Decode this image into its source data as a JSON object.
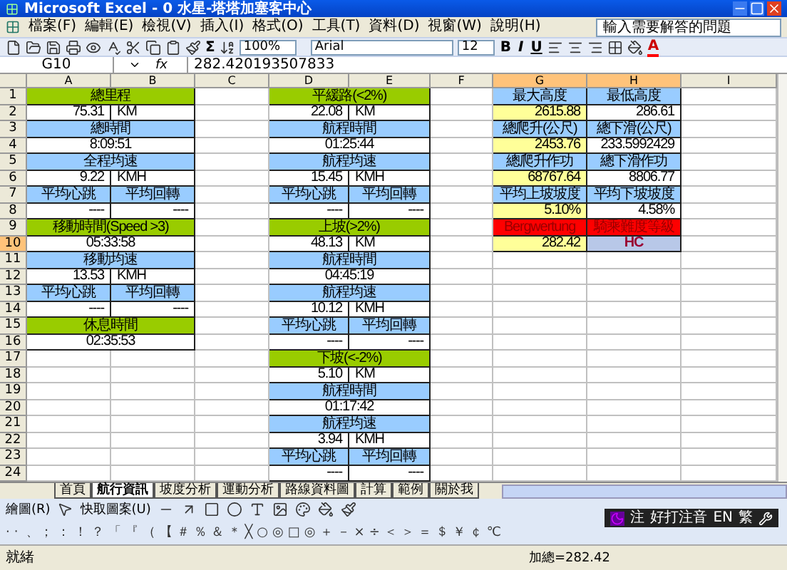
{
  "window": {
    "title": "Microsoft Excel - 0 水星-塔塔加塞客中心"
  },
  "menu": [
    "檔案(F)",
    "編輯(E)",
    "檢視(V)",
    "插入(I)",
    "格式(O)",
    "工具(T)",
    "資料(D)",
    "視窗(W)",
    "說明(H)"
  ],
  "help_box": {
    "placeholder": "輸入需要解答的問題"
  },
  "toolbar": {
    "sum": "Σ",
    "zoom": "100%",
    "font": "Arial",
    "size": "12",
    "format": [
      "B",
      "I",
      "U"
    ],
    "font_color": "A"
  },
  "formula_bar": {
    "name_box": "G10",
    "fx": "fx",
    "value": "282.420193507833"
  },
  "columns": [
    {
      "label": "A",
      "selected": false
    },
    {
      "label": "B",
      "selected": false
    },
    {
      "label": "C",
      "selected": false
    },
    {
      "label": "D",
      "selected": false
    },
    {
      "label": "E",
      "selected": false
    },
    {
      "label": "F",
      "selected": false
    },
    {
      "label": "G",
      "selected": true
    },
    {
      "label": "H",
      "selected": true
    },
    {
      "label": "I",
      "selected": false
    }
  ],
  "rows": [
    {
      "label": "1",
      "selected": false,
      "cells": [
        {
          "kind": "section",
          "merged": true,
          "text": "總里程"
        },
        {
          "kind": "blank",
          "merged": false
        },
        {
          "kind": "section",
          "merged": true,
          "text": "平緩路(<2%)"
        },
        {
          "kind": "blank",
          "merged": false
        },
        {
          "kind": "label",
          "merged": false,
          "text": "最大高度"
        },
        {
          "kind": "label",
          "merged": false,
          "text": "最低高度"
        },
        {
          "kind": "blank",
          "merged": false
        }
      ]
    },
    {
      "label": "2",
      "selected": false,
      "cells": [
        {
          "kind": "number",
          "merged": false,
          "text": "75.31"
        },
        {
          "kind": "unit",
          "merged": false,
          "text": "KM"
        },
        {
          "kind": "blank",
          "merged": false
        },
        {
          "kind": "number",
          "merged": false,
          "text": "22.08"
        },
        {
          "kind": "unit",
          "merged": false,
          "text": "KM"
        },
        {
          "kind": "blank",
          "merged": false
        },
        {
          "kind": "highlight",
          "merged": false,
          "text": "2615.88"
        },
        {
          "kind": "number",
          "merged": false,
          "text": "286.61"
        },
        {
          "kind": "blank",
          "merged": false
        }
      ]
    },
    {
      "label": "3",
      "selected": false,
      "cells": [
        {
          "kind": "label",
          "merged": true,
          "text": "總時間"
        },
        {
          "kind": "blank",
          "merged": false
        },
        {
          "kind": "label",
          "merged": true,
          "text": "航程時間"
        },
        {
          "kind": "blank",
          "merged": false
        },
        {
          "kind": "label",
          "merged": false,
          "text": "總爬升(公尺)"
        },
        {
          "kind": "label",
          "merged": false,
          "text": "總下滑(公尺)"
        },
        {
          "kind": "blank",
          "merged": false
        }
      ]
    },
    {
      "label": "4",
      "selected": false,
      "cells": [
        {
          "kind": "time",
          "merged": true,
          "text": "8:09:51"
        },
        {
          "kind": "blank",
          "merged": false
        },
        {
          "kind": "time",
          "merged": true,
          "text": "01:25:44"
        },
        {
          "kind": "blank",
          "merged": false
        },
        {
          "kind": "highlight",
          "merged": false,
          "text": "2453.76"
        },
        {
          "kind": "number",
          "merged": false,
          "text": "233.5992429"
        },
        {
          "kind": "blank",
          "merged": false
        }
      ]
    },
    {
      "label": "5",
      "selected": false,
      "cells": [
        {
          "kind": "label",
          "merged": true,
          "text": "全程均速"
        },
        {
          "kind": "blank",
          "merged": false
        },
        {
          "kind": "label",
          "merged": true,
          "text": "航程均速"
        },
        {
          "kind": "blank",
          "merged": false
        },
        {
          "kind": "label",
          "merged": false,
          "text": "總爬升作功"
        },
        {
          "kind": "label",
          "merged": false,
          "text": "總下滑作功"
        },
        {
          "kind": "blank",
          "merged": false
        }
      ]
    },
    {
      "label": "6",
      "selected": false,
      "cells": [
        {
          "kind": "number",
          "merged": false,
          "text": "9.22"
        },
        {
          "kind": "unit",
          "merged": false,
          "text": "KMH"
        },
        {
          "kind": "blank",
          "merged": false
        },
        {
          "kind": "number",
          "merged": false,
          "text": "15.45"
        },
        {
          "kind": "unit",
          "merged": false,
          "text": "KMH"
        },
        {
          "kind": "blank",
          "merged": false
        },
        {
          "kind": "highlight",
          "merged": false,
          "text": "68767.64"
        },
        {
          "kind": "number",
          "merged": false,
          "text": "8806.77"
        },
        {
          "kind": "blank",
          "merged": false
        }
      ]
    },
    {
      "label": "7",
      "selected": false,
      "cells": [
        {
          "kind": "label",
          "merged": false,
          "text": "平均心跳"
        },
        {
          "kind": "label",
          "merged": false,
          "text": "平均回轉"
        },
        {
          "kind": "blank",
          "merged": false
        },
        {
          "kind": "label",
          "merged": false,
          "text": "平均心跳"
        },
        {
          "kind": "label",
          "merged": false,
          "text": "平均回轉"
        },
        {
          "kind": "blank",
          "merged": false
        },
        {
          "kind": "label",
          "merged": false,
          "text": "平均上坡坡度"
        },
        {
          "kind": "label",
          "merged": false,
          "text": "平均下坡坡度"
        },
        {
          "kind": "blank",
          "merged": false
        }
      ]
    },
    {
      "label": "8",
      "selected": false,
      "cells": [
        {
          "kind": "number",
          "merged": false,
          "text": "----"
        },
        {
          "kind": "number",
          "merged": false,
          "text": "----"
        },
        {
          "kind": "blank",
          "merged": false
        },
        {
          "kind": "number",
          "merged": false,
          "text": "----"
        },
        {
          "kind": "number",
          "merged": false,
          "text": "----"
        },
        {
          "kind": "blank",
          "merged": false
        },
        {
          "kind": "highlight",
          "merged": false,
          "text": "5.10%"
        },
        {
          "kind": "number",
          "merged": false,
          "text": "4.58%"
        },
        {
          "kind": "blank",
          "merged": false
        }
      ]
    },
    {
      "label": "9",
      "selected": false,
      "cells": [
        {
          "kind": "section",
          "merged": true,
          "text": "移動時間(Speed >3)"
        },
        {
          "kind": "blank",
          "merged": false
        },
        {
          "kind": "section",
          "merged": true,
          "text": "上坡(>2%)"
        },
        {
          "kind": "blank",
          "merged": false
        },
        {
          "kind": "alert",
          "merged": false,
          "text": "Bergwertung"
        },
        {
          "kind": "alert",
          "merged": false,
          "text": "騎乘難度等級"
        },
        {
          "kind": "blank",
          "merged": false
        }
      ]
    },
    {
      "label": "10",
      "selected": true,
      "cells": [
        {
          "kind": "time",
          "merged": true,
          "text": "05:33:58"
        },
        {
          "kind": "blank",
          "merged": false
        },
        {
          "kind": "number",
          "merged": false,
          "text": "48.13"
        },
        {
          "kind": "unit",
          "merged": false,
          "text": "KM"
        },
        {
          "kind": "blank",
          "merged": false
        },
        {
          "kind": "highlight",
          "merged": false,
          "text": "282.42"
        },
        {
          "kind": "grade",
          "merged": false,
          "text": "HC"
        },
        {
          "kind": "blank",
          "merged": false
        }
      ]
    },
    {
      "label": "11",
      "selected": false,
      "cells": [
        {
          "kind": "label",
          "merged": true,
          "text": "移動均速"
        },
        {
          "kind": "blank",
          "merged": false
        },
        {
          "kind": "label",
          "merged": true,
          "text": "航程時間"
        },
        {
          "kind": "blank",
          "merged": false
        },
        {
          "kind": "blank",
          "merged": false
        },
        {
          "kind": "blank",
          "merged": false
        },
        {
          "kind": "blank",
          "merged": false
        }
      ]
    },
    {
      "label": "12",
      "selected": false,
      "cells": [
        {
          "kind": "number",
          "merged": false,
          "text": "13.53"
        },
        {
          "kind": "unit",
          "merged": false,
          "text": "KMH"
        },
        {
          "kind": "blank",
          "merged": false
        },
        {
          "kind": "time",
          "merged": true,
          "text": "04:45:19"
        },
        {
          "kind": "blank",
          "merged": false
        },
        {
          "kind": "blank",
          "merged": false
        },
        {
          "kind": "blank",
          "merged": false
        },
        {
          "kind": "blank",
          "merged": false
        }
      ]
    },
    {
      "label": "13",
      "selected": false,
      "cells": [
        {
          "kind": "label",
          "merged": false,
          "text": "平均心跳"
        },
        {
          "kind": "label",
          "merged": false,
          "text": "平均回轉"
        },
        {
          "kind": "blank",
          "merged": false
        },
        {
          "kind": "label",
          "merged": true,
          "text": "航程均速"
        },
        {
          "kind": "blank",
          "merged": false
        },
        {
          "kind": "blank",
          "merged": false
        },
        {
          "kind": "blank",
          "merged": false
        },
        {
          "kind": "blank",
          "merged": false
        }
      ]
    },
    {
      "label": "14",
      "selected": false,
      "cells": [
        {
          "kind": "number",
          "merged": false,
          "text": "----"
        },
        {
          "kind": "number",
          "merged": false,
          "text": "----"
        },
        {
          "kind": "blank",
          "merged": false
        },
        {
          "kind": "number",
          "merged": false,
          "text": "10.12"
        },
        {
          "kind": "unit",
          "merged": false,
          "text": "KMH"
        },
        {
          "kind": "blank",
          "merged": false
        },
        {
          "kind": "blank",
          "merged": false
        },
        {
          "kind": "blank",
          "merged": false
        },
        {
          "kind": "blank",
          "merged": false
        }
      ]
    },
    {
      "label": "15",
      "selected": false,
      "cells": [
        {
          "kind": "section",
          "merged": true,
          "text": "休息時間"
        },
        {
          "kind": "blank",
          "merged": false
        },
        {
          "kind": "label",
          "merged": false,
          "text": "平均心跳"
        },
        {
          "kind": "label",
          "merged": false,
          "text": "平均回轉"
        },
        {
          "kind": "blank",
          "merged": false
        },
        {
          "kind": "blank",
          "merged": false
        },
        {
          "kind": "blank",
          "merged": false
        },
        {
          "kind": "blank",
          "merged": false
        }
      ]
    },
    {
      "label": "16",
      "selected": false,
      "cells": [
        {
          "kind": "time",
          "merged": true,
          "text": "02:35:53"
        },
        {
          "kind": "blank",
          "merged": false
        },
        {
          "kind": "number",
          "merged": false,
          "text": "----"
        },
        {
          "kind": "number",
          "merged": false,
          "text": "----"
        },
        {
          "kind": "blank",
          "merged": false
        },
        {
          "kind": "blank",
          "merged": false
        },
        {
          "kind": "blank",
          "merged": false
        },
        {
          "kind": "blank",
          "merged": false
        }
      ]
    },
    {
      "label": "17",
      "selected": false,
      "cells": [
        {
          "kind": "blank",
          "merged": false
        },
        {
          "kind": "blank",
          "merged": false
        },
        {
          "kind": "blank",
          "merged": false
        },
        {
          "kind": "section",
          "merged": true,
          "text": "下坡(<-2%)"
        },
        {
          "kind": "blank",
          "merged": false
        },
        {
          "kind": "blank",
          "merged": false
        },
        {
          "kind": "blank",
          "merged": false
        },
        {
          "kind": "blank",
          "merged": false
        }
      ]
    },
    {
      "label": "18",
      "selected": false,
      "cells": [
        {
          "kind": "blank",
          "merged": false
        },
        {
          "kind": "blank",
          "merged": false
        },
        {
          "kind": "blank",
          "merged": false
        },
        {
          "kind": "number",
          "merged": false,
          "text": "5.10"
        },
        {
          "kind": "unit",
          "merged": false,
          "text": "KM"
        },
        {
          "kind": "blank",
          "merged": false
        },
        {
          "kind": "blank",
          "merged": false
        },
        {
          "kind": "blank",
          "merged": false
        },
        {
          "kind": "blank",
          "merged": false
        }
      ]
    },
    {
      "label": "19",
      "selected": false,
      "cells": [
        {
          "kind": "blank",
          "merged": false
        },
        {
          "kind": "blank",
          "merged": false
        },
        {
          "kind": "blank",
          "merged": false
        },
        {
          "kind": "label",
          "merged": true,
          "text": "航程時間"
        },
        {
          "kind": "blank",
          "merged": false
        },
        {
          "kind": "blank",
          "merged": false
        },
        {
          "kind": "blank",
          "merged": false
        },
        {
          "kind": "blank",
          "merged": false
        }
      ]
    },
    {
      "label": "20",
      "selected": false,
      "cells": [
        {
          "kind": "blank",
          "merged": false
        },
        {
          "kind": "blank",
          "merged": false
        },
        {
          "kind": "blank",
          "merged": false
        },
        {
          "kind": "time",
          "merged": true,
          "text": "01:17:42"
        },
        {
          "kind": "blank",
          "merged": false
        },
        {
          "kind": "blank",
          "merged": false
        },
        {
          "kind": "blank",
          "merged": false
        },
        {
          "kind": "blank",
          "merged": false
        }
      ]
    },
    {
      "label": "21",
      "selected": false,
      "cells": [
        {
          "kind": "blank",
          "merged": false
        },
        {
          "kind": "blank",
          "merged": false
        },
        {
          "kind": "blank",
          "merged": false
        },
        {
          "kind": "label",
          "merged": true,
          "text": "航程均速"
        },
        {
          "kind": "blank",
          "merged": false
        },
        {
          "kind": "blank",
          "merged": false
        },
        {
          "kind": "blank",
          "merged": false
        },
        {
          "kind": "blank",
          "merged": false
        }
      ]
    },
    {
      "label": "22",
      "selected": false,
      "cells": [
        {
          "kind": "blank",
          "merged": false
        },
        {
          "kind": "blank",
          "merged": false
        },
        {
          "kind": "blank",
          "merged": false
        },
        {
          "kind": "number",
          "merged": false,
          "text": "3.94"
        },
        {
          "kind": "unit",
          "merged": false,
          "text": "KMH"
        },
        {
          "kind": "blank",
          "merged": false
        },
        {
          "kind": "blank",
          "merged": false
        },
        {
          "kind": "blank",
          "merged": false
        },
        {
          "kind": "blank",
          "merged": false
        }
      ]
    },
    {
      "label": "23",
      "selected": false,
      "cells": [
        {
          "kind": "blank",
          "merged": false
        },
        {
          "kind": "blank",
          "merged": false
        },
        {
          "kind": "blank",
          "merged": false
        },
        {
          "kind": "label",
          "merged": false,
          "text": "平均心跳"
        },
        {
          "kind": "label",
          "merged": false,
          "text": "平均回轉"
        },
        {
          "kind": "blank",
          "merged": false
        },
        {
          "kind": "blank",
          "merged": false
        },
        {
          "kind": "blank",
          "merged": false
        },
        {
          "kind": "blank",
          "merged": false
        }
      ]
    },
    {
      "label": "24",
      "selected": false,
      "cells": [
        {
          "kind": "blank",
          "merged": false
        },
        {
          "kind": "blank",
          "merged": false
        },
        {
          "kind": "blank",
          "merged": false
        },
        {
          "kind": "number",
          "merged": false,
          "text": "----"
        },
        {
          "kind": "number",
          "merged": false,
          "text": "----"
        },
        {
          "kind": "blank",
          "merged": false
        },
        {
          "kind": "blank",
          "merged": false
        },
        {
          "kind": "blank",
          "merged": false
        },
        {
          "kind": "blank",
          "merged": false
        }
      ]
    }
  ],
  "sheet_tabs": [
    {
      "label": "首頁",
      "selected": false
    },
    {
      "label": "航行資訊",
      "selected": true
    },
    {
      "label": "坡度分析",
      "selected": false
    },
    {
      "label": "運動分析",
      "selected": false
    },
    {
      "label": "路線資料圖",
      "selected": false
    },
    {
      "label": "計算",
      "selected": false
    },
    {
      "label": "範例",
      "selected": false
    },
    {
      "label": "關於我",
      "selected": false
    }
  ],
  "drawing_toolbar": {
    "draw": "繪圖(R)",
    "autoshapes": "快取圖案(U)"
  },
  "symbols": [
    "·",
    "‧",
    "﹑",
    "；",
    "：",
    "！",
    "？",
    "「",
    "『",
    "（",
    "【",
    "＃",
    "％",
    "＆",
    "＊",
    "╳",
    "○",
    "◎",
    "□",
    "◎",
    "＋",
    "－",
    "×",
    "÷",
    "＜",
    "＞",
    "＝",
    "＄",
    "￥",
    "￠",
    "℃"
  ],
  "ime": {
    "mode": "注",
    "name": "好打注音",
    "lang": "EN",
    "script": "繁"
  },
  "status_bar": {
    "state": "就緒",
    "sum": "加總=282.42"
  }
}
